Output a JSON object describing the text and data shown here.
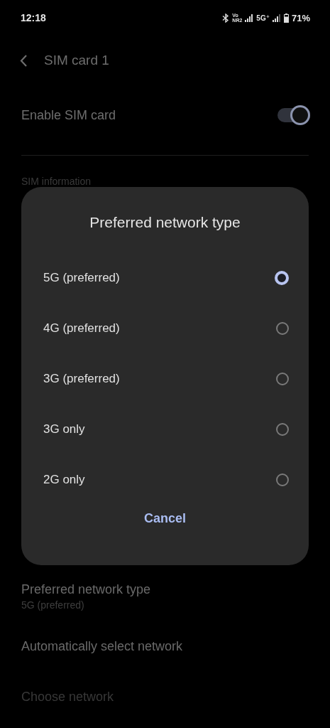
{
  "status_bar": {
    "time": "12:18",
    "volte": "Vo",
    "nr": "NR2",
    "network": "5G⁺",
    "battery": "71%"
  },
  "header": {
    "title": "SIM card 1"
  },
  "enable_sim": {
    "label": "Enable SIM card",
    "on": true
  },
  "section_label": "SIM information",
  "dialog": {
    "title": "Preferred network type",
    "options": [
      {
        "label": "5G (preferred)",
        "selected": true
      },
      {
        "label": "4G (preferred)",
        "selected": false
      },
      {
        "label": "3G (preferred)",
        "selected": false
      },
      {
        "label": "3G only",
        "selected": false
      },
      {
        "label": "2G only",
        "selected": false
      }
    ],
    "cancel": "Cancel"
  },
  "settings": [
    {
      "title": "Preferred network type",
      "subtitle": "5G (preferred)",
      "disabled": false
    },
    {
      "title": "Automatically select network",
      "disabled": false
    },
    {
      "title": "Choose network",
      "disabled": true
    }
  ]
}
